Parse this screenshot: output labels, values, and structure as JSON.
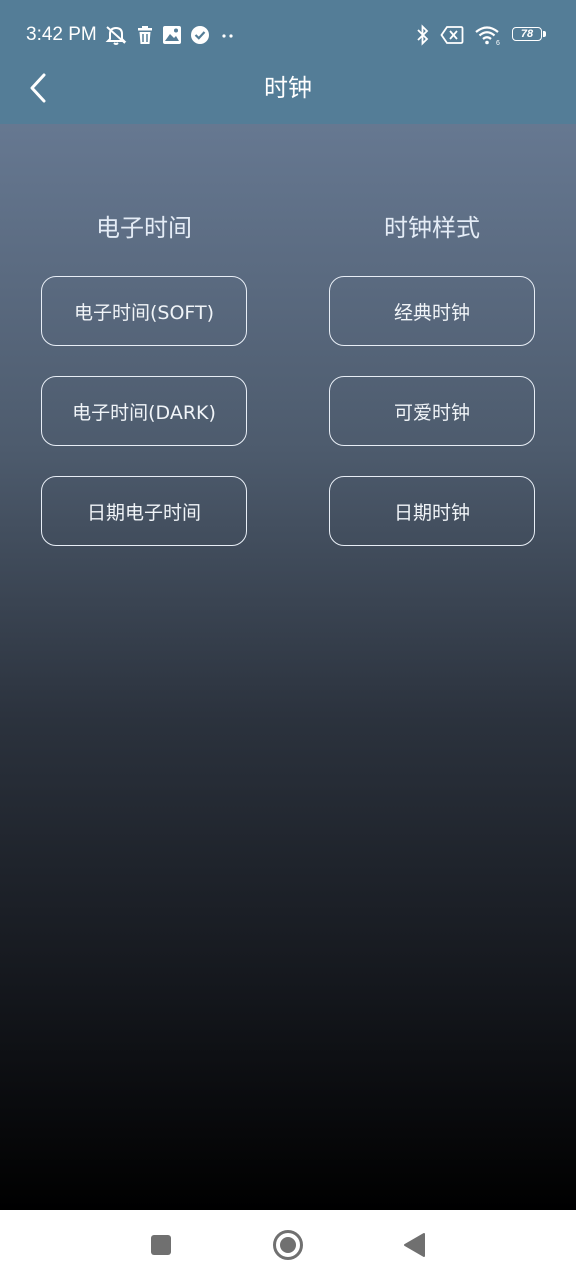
{
  "status_bar": {
    "time": "3:42 PM",
    "left_icons": [
      "mute-icon",
      "trash-icon",
      "image-icon",
      "check-circle-icon",
      "more-dots-icon"
    ],
    "right_icons": [
      "bluetooth-icon",
      "sim-off-icon",
      "wifi-icon",
      "battery-icon"
    ],
    "battery_level": "78"
  },
  "app_bar": {
    "title": "时钟",
    "back_icon": "chevron-left-icon"
  },
  "columns": [
    {
      "title": "电子时间",
      "buttons": [
        "电子时间(SOFT)",
        "电子时间(DARK)",
        "日期电子时间"
      ]
    },
    {
      "title": "时钟样式",
      "buttons": [
        "经典时钟",
        "可爱时钟",
        "日期时钟"
      ]
    }
  ],
  "nav_bar": {
    "icons": [
      "recents-square-icon",
      "home-circle-icon",
      "back-triangle-icon"
    ]
  },
  "colors": {
    "app_bar": "#547d97",
    "content_top": "#667891",
    "content_bottom": "#000000",
    "button_border": "#e8eef6",
    "nav_bar": "#ffffff"
  }
}
